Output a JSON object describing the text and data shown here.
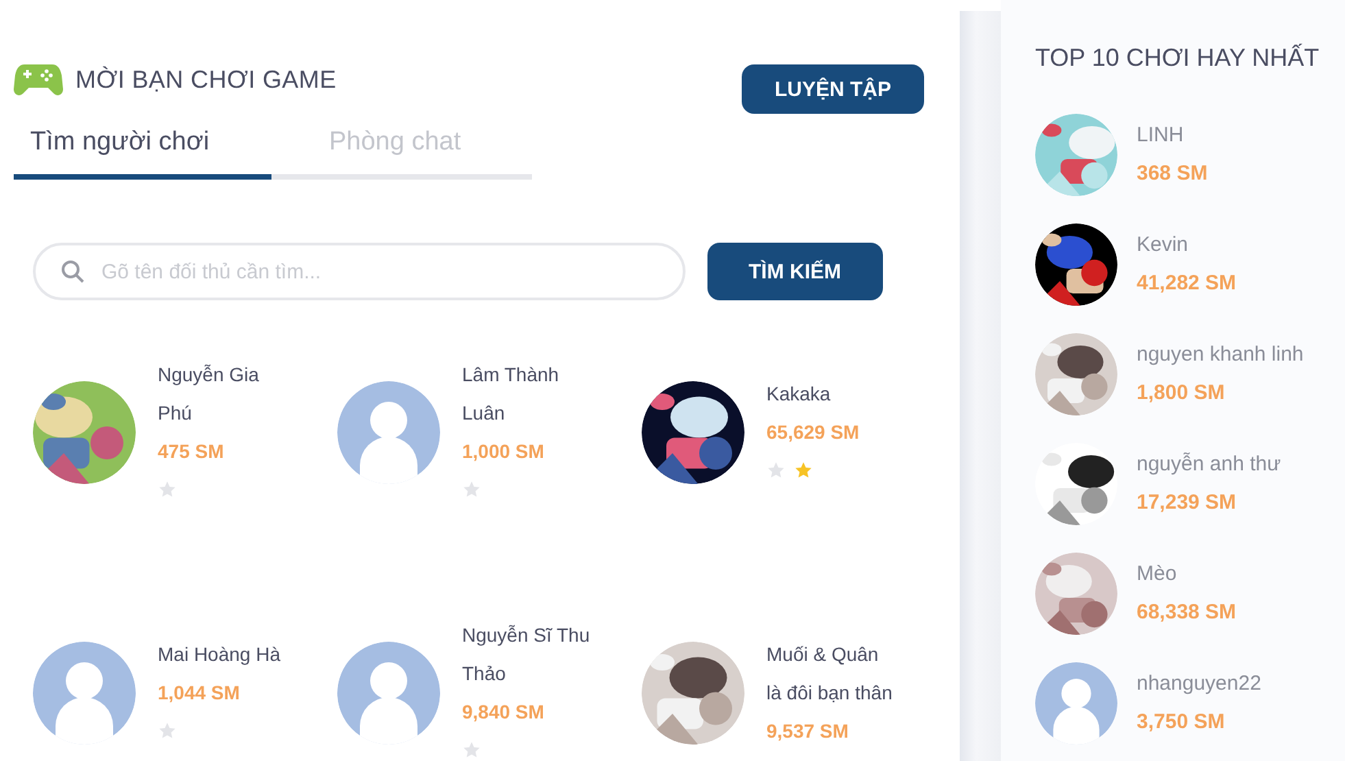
{
  "header": {
    "title": "MỜI BẠN CHƠI GAME",
    "practice_button": "LUYỆN TẬP"
  },
  "tabs": [
    {
      "label": "Tìm người chơi",
      "selected": true
    },
    {
      "label": "Phòng chat",
      "selected": false
    }
  ],
  "search": {
    "placeholder": "Gõ tên đối thủ cần tìm...",
    "button": "TÌM KIẾM"
  },
  "players": [
    {
      "name": "Nguyễn Gia Phú",
      "score": "475 SM",
      "kind": "picture",
      "star_marks": [
        {
          "filled": false
        }
      ]
    },
    {
      "name": "Lâm Thành Luân",
      "score": "1,000 SM",
      "kind": "default",
      "star_marks": [
        {
          "filled": false
        }
      ]
    },
    {
      "name": "Kakaka",
      "score": "65,629 SM",
      "kind": "picture",
      "star_marks": [
        {
          "filled": false
        },
        {
          "filled": true
        }
      ]
    },
    {
      "name": "Mai Hoàng Hà",
      "score": "1,044 SM",
      "kind": "default",
      "star_marks": [
        {
          "filled": false
        }
      ]
    },
    {
      "name": "Nguyễn Sĩ Thu Thảo",
      "score": "9,840 SM",
      "kind": "default",
      "star_marks": [
        {
          "filled": false
        }
      ]
    },
    {
      "name": "Muối & Quân là đôi bạn thân",
      "score": "9,537 SM",
      "kind": "picture"
    }
  ],
  "top": {
    "title": "TOP 10 CHƠI HAY NHẤT",
    "items": [
      {
        "name": "LINH",
        "score": "368 SM",
        "kind": "picture"
      },
      {
        "name": "Kevin",
        "score": "41,282 SM",
        "kind": "picture"
      },
      {
        "name": "nguyen khanh linh",
        "score": "1,800 SM",
        "kind": "picture"
      },
      {
        "name": "nguyễn anh thư",
        "score": "17,239 SM",
        "kind": "picture"
      },
      {
        "name": "Mèo",
        "score": "68,338 SM",
        "kind": "picture"
      },
      {
        "name": "nhanguyen22",
        "score": "3,750 SM",
        "kind": "default"
      }
    ]
  }
}
